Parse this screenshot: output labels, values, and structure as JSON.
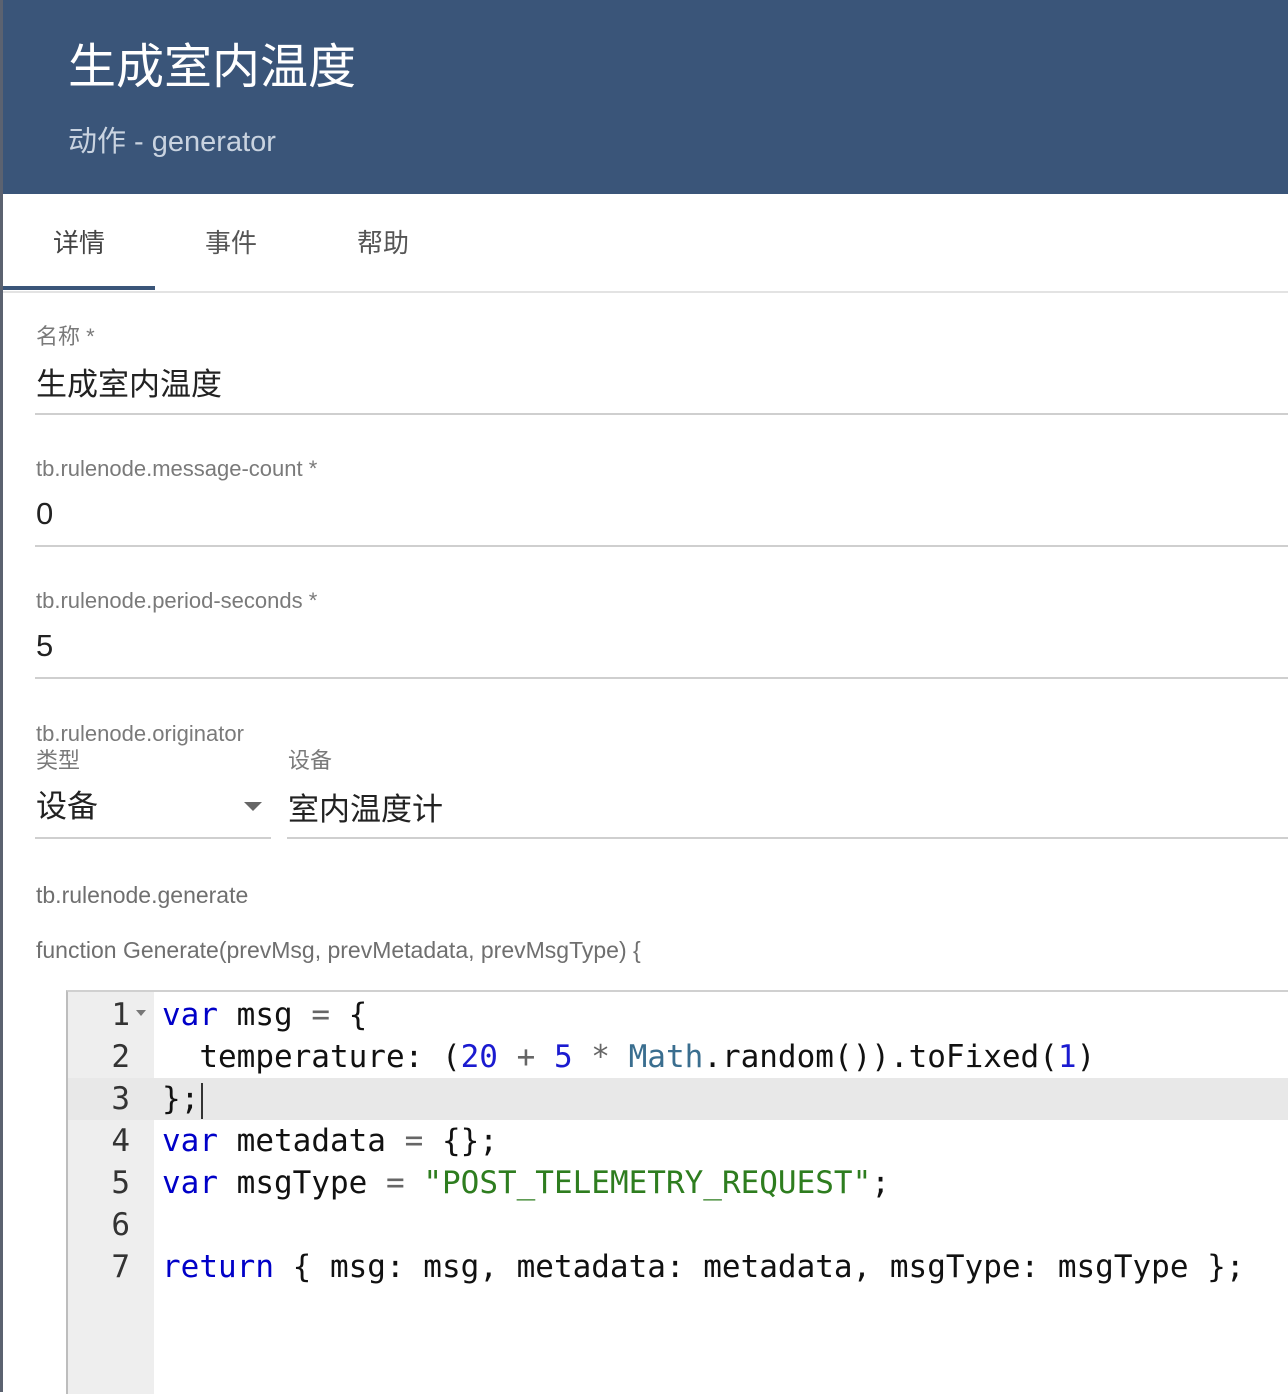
{
  "header": {
    "title": "生成室内温度",
    "subtitle": "动作 - generator"
  },
  "tabs": [
    {
      "label": "详情",
      "active": true
    },
    {
      "label": "事件",
      "active": false
    },
    {
      "label": "帮助",
      "active": false
    }
  ],
  "form": {
    "name": {
      "label": "名称 *",
      "value": "生成室内温度"
    },
    "message_count": {
      "label": "tb.rulenode.message-count *",
      "value": "0"
    },
    "period_seconds": {
      "label": "tb.rulenode.period-seconds *",
      "value": "5"
    },
    "originator_type": {
      "label_line1": "tb.rulenode.originator",
      "label_line2": "类型",
      "value": "设备"
    },
    "device": {
      "label": "设备",
      "value": "室内温度计"
    },
    "generate_label": "tb.rulenode.generate",
    "function_signature": "function Generate(prevMsg, prevMetadata, prevMsgType) {"
  },
  "editor": {
    "active_line": 3,
    "line_numbers": [
      "1",
      "2",
      "3",
      "4",
      "5",
      "6",
      "7"
    ],
    "tokens": {
      "l1": {
        "kw": "var",
        "rest": " msg ",
        "op": "=",
        "tail": " {"
      },
      "l2": {
        "a": "  temperature: (",
        "n1": "20",
        "op1": " + ",
        "n2": "5",
        "op2": " * ",
        "builtin": "Math",
        "b": ".random()).toFixed(",
        "n3": "1",
        "c": ")"
      },
      "l3": {
        "text": "};"
      },
      "l4": {
        "kw": "var",
        "rest": " metadata ",
        "op": "=",
        "tail": " {};"
      },
      "l5": {
        "kw": "var",
        "rest": " msgType ",
        "op": "=",
        "sp": " ",
        "str": "\"POST_TELEMETRY_REQUEST\"",
        "tail": ";"
      },
      "l7": {
        "kw": "return",
        "rest": " { msg: msg, metadata: metadata, msgType: msgType };"
      }
    }
  },
  "colors": {
    "header_bg": "#3a5579",
    "keyword": "#0000c8",
    "number": "#1b1bd0",
    "string": "#2e7d1f"
  }
}
